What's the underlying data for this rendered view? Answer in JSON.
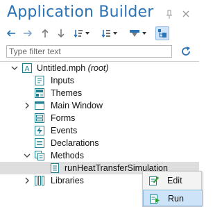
{
  "panel": {
    "title": "Application Builder"
  },
  "icons": {
    "pin": "pin-icon",
    "close": "close-icon",
    "toolbar": [
      "arrow-left-icon",
      "arrow-right-icon",
      "arrow-up-icon",
      "arrow-down-icon",
      "sort-icon",
      "collapse-icon",
      "show-icon",
      "model-tree-icon"
    ],
    "refresh": "refresh-icon"
  },
  "filter": {
    "placeholder": "Type filter text",
    "value": ""
  },
  "tree": {
    "root": {
      "name": "Untitled.mph",
      "suffix": "(root)"
    },
    "items": [
      {
        "label": "Inputs"
      },
      {
        "label": "Themes"
      },
      {
        "label": "Main Window"
      },
      {
        "label": "Forms"
      },
      {
        "label": "Events"
      },
      {
        "label": "Declarations"
      },
      {
        "label": "Methods"
      },
      {
        "label": "runHeatTransferSimulation"
      },
      {
        "label": "Libraries"
      }
    ]
  },
  "context_menu": {
    "items": [
      {
        "label": "Edit"
      },
      {
        "label": "Run"
      }
    ]
  },
  "colors": {
    "title": "#2c73b6",
    "icon_blue": "#2c73b6",
    "icon_teal": "#1f7f8c",
    "selection": "#dedede",
    "menu_hover": "#cde3f7"
  }
}
